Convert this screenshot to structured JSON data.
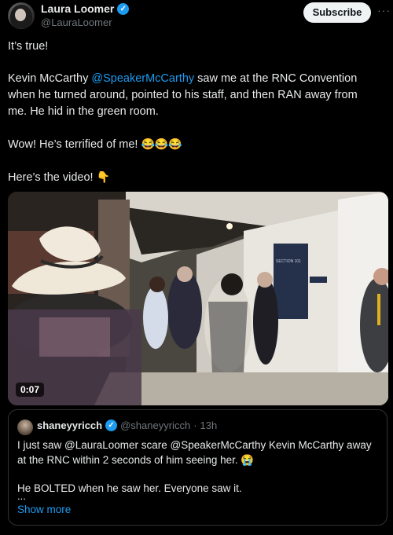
{
  "author": {
    "display_name": "Laura Loomer",
    "handle": "@LauraLoomer",
    "verified_badge": "verified-icon"
  },
  "header": {
    "subscribe_label": "Subscribe",
    "more_label": "···"
  },
  "tweet": {
    "para1": "It’s true!",
    "para2_before": "Kevin McCarthy ",
    "para2_mention": "@SpeakerMcCarthy",
    "para2_after": " saw me at the RNC Convention when he turned around, pointed to his staff, and then RAN away from me. He hid in the green room.",
    "para3_text": "Wow! He’s terrified of me! ",
    "para3_emoji": "😂😂😂",
    "para4_text": "Here’s the video! ",
    "para4_emoji": "👇"
  },
  "media": {
    "duration": "0:07",
    "sign_title": "SECTION 101"
  },
  "quote": {
    "display_name": "shaneyyricch",
    "handle": "@shaneyyricch",
    "dot": "·",
    "time": "13h",
    "line1": "I just saw @LauraLoomer scare @SpeakerMcCarthy Kevin McCarthy away at the RNC within 2 seconds of him seeing her. ",
    "line1_emoji": "😭",
    "line2": "He BOLTED when he saw her. Everyone saw it.",
    "ellipsis": "...",
    "show_more": "Show more"
  },
  "colors": {
    "background": "#000000",
    "text": "#e7e9ea",
    "secondary": "#71767b",
    "link": "#1d9bf0",
    "border": "#2f3336"
  }
}
